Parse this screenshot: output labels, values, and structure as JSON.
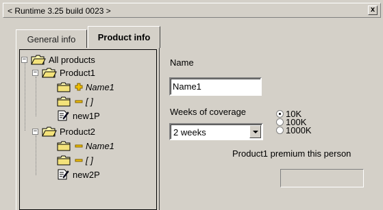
{
  "window": {
    "title": "< Runtime 3.25 build 0023 >",
    "close_glyph": "x"
  },
  "tabs": [
    {
      "label": "General info"
    },
    {
      "label": "Product info"
    }
  ],
  "tree": {
    "root": "All products",
    "expand_glyph": "−",
    "products": [
      {
        "label": "Product1",
        "children": [
          {
            "label": "Name1"
          },
          {
            "label": "[ ]"
          },
          {
            "label": "new1P"
          }
        ]
      },
      {
        "label": "Product2",
        "children": [
          {
            "label": "Name1"
          },
          {
            "label": "[ ]"
          },
          {
            "label": "new2P"
          }
        ]
      }
    ]
  },
  "form": {
    "name_label": "Name",
    "name_value": "Name1",
    "weeks_label": "Weeks of coverage",
    "weeks_selected": "2 weeks",
    "radios": [
      {
        "label": "10K",
        "selected": true
      },
      {
        "label": "100K",
        "selected": false
      },
      {
        "label": "1000K",
        "selected": false
      }
    ],
    "premium_label": "Product1 premium this person",
    "premium_value": ""
  }
}
